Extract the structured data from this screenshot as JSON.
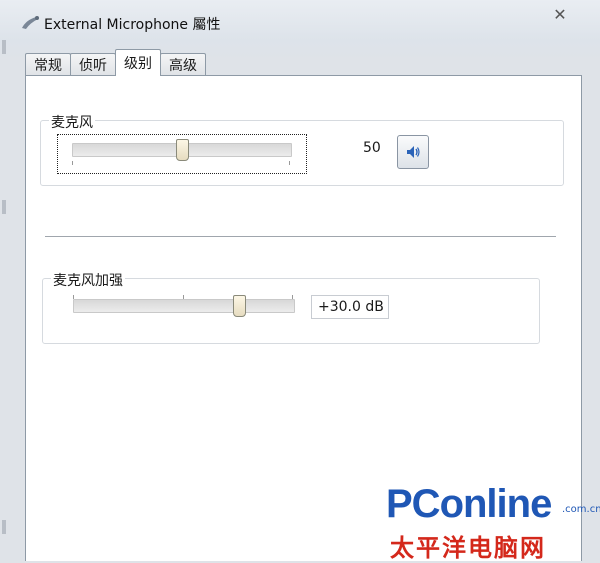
{
  "window": {
    "title": "External Microphone 屬性",
    "close_symbol": "✕"
  },
  "tabs": [
    {
      "label": "常规",
      "active": false
    },
    {
      "label": "侦听",
      "active": false
    },
    {
      "label": "级别",
      "active": true
    },
    {
      "label": "高级",
      "active": false
    }
  ],
  "microphone": {
    "label": "麦克风",
    "level": 50,
    "level_display": "50",
    "speaker_icon": "speaker-icon"
  },
  "boost": {
    "label": "麦克风加强",
    "level": 0.75,
    "value_display": "+30.0 dB"
  },
  "watermark": {
    "domain": "PConline",
    "suffix": ".com.cn",
    "name_cn": "太平洋电脑网"
  }
}
